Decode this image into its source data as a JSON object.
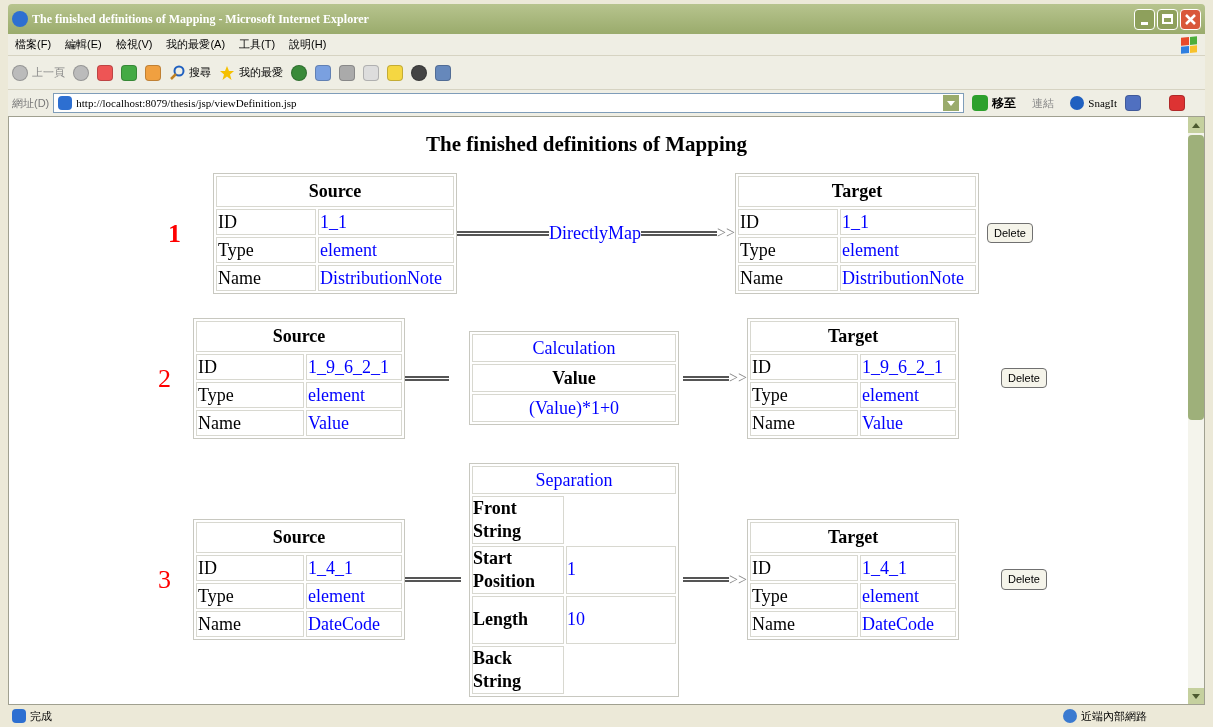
{
  "window": {
    "title": "The finished definitions of Mapping - Microsoft Internet Explorer"
  },
  "menu": [
    "檔案(F)",
    "編輯(E)",
    "檢視(V)",
    "我的最愛(A)",
    "工具(T)",
    "說明(H)"
  ],
  "toolbar": {
    "back": "上一頁",
    "search": "搜尋",
    "favorites": "我的最愛"
  },
  "address": {
    "label": "網址(D)",
    "url": "http://localhost:8079/thesis/jsp/viewDefinition.jsp",
    "go": "移至",
    "links": "連結",
    "snagit": "SnagIt"
  },
  "page": {
    "heading": "The finished definitions of Mapping",
    "mappings": [
      {
        "number": "1",
        "emphasized": true,
        "source": {
          "title": "Source",
          "rows": [
            [
              "ID",
              "1_1"
            ],
            [
              "Type",
              "element"
            ],
            [
              "Name",
              "DistributionNote"
            ]
          ]
        },
        "transform": {
          "kind": "direct",
          "label": "DirectlyMap"
        },
        "arrow_tip": ">>",
        "target": {
          "title": "Target",
          "rows": [
            [
              "ID",
              "1_1"
            ],
            [
              "Type",
              "element"
            ],
            [
              "Name",
              "DistributionNote"
            ]
          ]
        },
        "delete": "Delete"
      },
      {
        "number": "2",
        "emphasized": false,
        "source": {
          "title": "Source",
          "rows": [
            [
              "ID",
              "1_9_6_2_1"
            ],
            [
              "Type",
              "element"
            ],
            [
              "Name",
              "Value"
            ]
          ]
        },
        "transform": {
          "kind": "calculation",
          "label": "Calculation",
          "field": "Value",
          "formula": "(Value)*1+0"
        },
        "arrow_tip": ">>",
        "target": {
          "title": "Target",
          "rows": [
            [
              "ID",
              "1_9_6_2_1"
            ],
            [
              "Type",
              "element"
            ],
            [
              "Name",
              "Value"
            ]
          ]
        },
        "delete": "Delete"
      },
      {
        "number": "3",
        "emphasized": false,
        "source": {
          "title": "Source",
          "rows": [
            [
              "ID",
              "1_4_1"
            ],
            [
              "Type",
              "element"
            ],
            [
              "Name",
              "DateCode"
            ]
          ]
        },
        "transform": {
          "kind": "separation",
          "label": "Separation",
          "rows": [
            [
              "Front String",
              ""
            ],
            [
              "Start Position",
              "1"
            ],
            [
              "Length",
              "10"
            ],
            [
              "Back String",
              ""
            ]
          ]
        },
        "arrow_tip": ">>",
        "target": {
          "title": "Target",
          "rows": [
            [
              "ID",
              "1_4_1"
            ],
            [
              "Type",
              "element"
            ],
            [
              "Name",
              "DateCode"
            ]
          ]
        },
        "delete": "Delete"
      }
    ]
  },
  "status_bar": {
    "text": "完成",
    "zone": "近端內部網路"
  }
}
